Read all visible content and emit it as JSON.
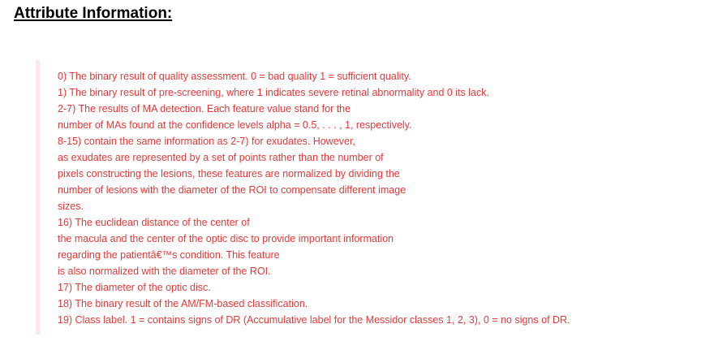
{
  "heading": "Attribute Information:",
  "colors": {
    "text": "#dd3b3b",
    "quote_bar": "#fbe9e9",
    "heading": "#000000"
  },
  "lines": [
    "0) The binary result of quality assessment. 0 = bad quality 1 = sufficient quality.",
    "1) The binary result of pre-screening, where 1 indicates severe retinal abnormality and 0 its lack.",
    "2-7) The results of MA detection. Each feature value stand for the",
    "number of MAs found at the confidence levels alpha = 0.5, . . . , 1, respectively.",
    "8-15) contain the same information as 2-7) for exudates. However,",
    "as exudates are represented by a set of points rather than the number of",
    "pixels constructing the lesions, these features are normalized by dividing the",
    "number of lesions with the diameter of the ROI to compensate different image",
    "sizes.",
    "16) The euclidean distance of the center of",
    "the macula and the center of the optic disc to provide important information",
    "regarding the patientâ€™s condition. This feature",
    "is also normalized with the diameter of the ROI.",
    "17) The diameter of the optic disc.",
    "18) The binary result of the AM/FM-based classification.",
    "19) Class label. 1 = contains signs of DR (Accumulative label for the Messidor classes 1, 2, 3), 0 = no signs of DR."
  ]
}
